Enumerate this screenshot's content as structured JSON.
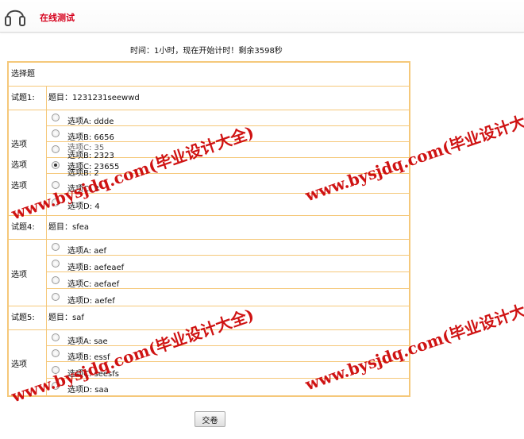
{
  "header": {
    "title": "在线测试"
  },
  "timer": "时间：1小时，现在开始计时！剩余3598秒",
  "section_title": "选择题",
  "questions": [
    {
      "label": "试题1:",
      "text": "题目：1231231seewwd",
      "option_label": "选项",
      "options": [
        {
          "text": "选项A: ddde",
          "checked": false
        },
        {
          "text": "选项B: 6656",
          "checked": false
        }
      ]
    }
  ],
  "overlap": {
    "label_top": "选项",
    "label_bottom": "选项",
    "options": [
      {
        "text": "选项B: 2323",
        "ghost": "选项C: 35",
        "checked": false
      },
      {
        "text": "选项C: 23655",
        "ghost": "选项B: 2",
        "checked": true
      },
      {
        "text": "选项C: 3",
        "checked": false
      },
      {
        "text": "选项D: 4",
        "checked": false
      }
    ]
  },
  "q4": {
    "label": "试题4:",
    "text": "题目：sfea",
    "option_label": "选项",
    "options": [
      {
        "text": "选项A: aef",
        "checked": false
      },
      {
        "text": "选项B: aefeaef",
        "checked": false
      },
      {
        "text": "选项C: aefaef",
        "checked": false
      },
      {
        "text": "选项D: aefef",
        "checked": false
      }
    ]
  },
  "q5": {
    "label": "试题5:",
    "text": "题目：saf",
    "option_label": "选项",
    "options": [
      {
        "text": "选项A: sae",
        "checked": false
      },
      {
        "text": "选项B: essf",
        "checked": false
      },
      {
        "text": "选项C: seesfs",
        "checked": false
      },
      {
        "text": "选项D: saa",
        "checked": false
      }
    ]
  },
  "submit_label": "交卷",
  "watermark": "www.bysjdq.com(毕业设计大全)"
}
